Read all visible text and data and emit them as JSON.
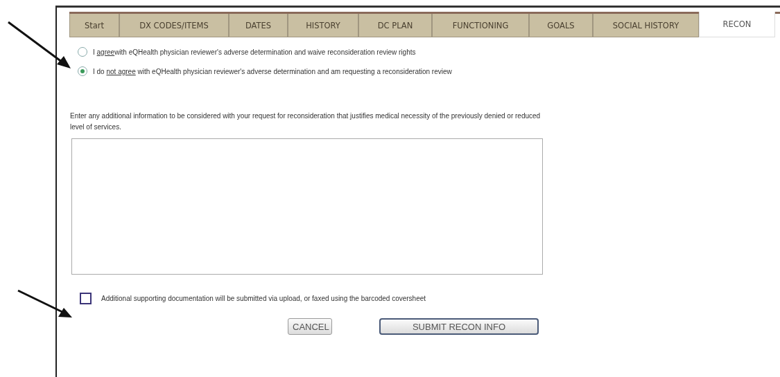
{
  "tabs": [
    {
      "label": "Start",
      "selected": false
    },
    {
      "label": "DX CODES/ITEMS",
      "selected": false
    },
    {
      "label": "DATES",
      "selected": false
    },
    {
      "label": "HISTORY",
      "selected": false
    },
    {
      "label": "DC PLAN",
      "selected": false
    },
    {
      "label": "FUNCTIONING",
      "selected": false
    },
    {
      "label": "GOALS",
      "selected": false
    },
    {
      "label": "SOCIAL HISTORY",
      "selected": false
    },
    {
      "label": "RECON",
      "selected": true
    }
  ],
  "options": [
    {
      "before": "I ",
      "link": "agree",
      "after": "with eQHealth physician reviewer's adverse determination and waive  reconsideration review rights",
      "selected": false
    },
    {
      "before": "I do ",
      "link": "not agree",
      "after": " with eQHealth physician reviewer's adverse determination and am requesting a reconsideration review",
      "selected": true
    }
  ],
  "instructions": "Enter any additional information to be considered with your request for reconsideration that justifies medical necessity of the previously denied or reduced level of services.",
  "documentation_checkbox": {
    "label": "Additional supporting documentation will be submitted via upload, or faxed using the barcoded coversheet",
    "checked": false
  },
  "buttons": [
    {
      "label": "CANCEL",
      "kind": "cancel"
    },
    {
      "label": "SUBMIT RECON INFO",
      "kind": "submit"
    }
  ]
}
